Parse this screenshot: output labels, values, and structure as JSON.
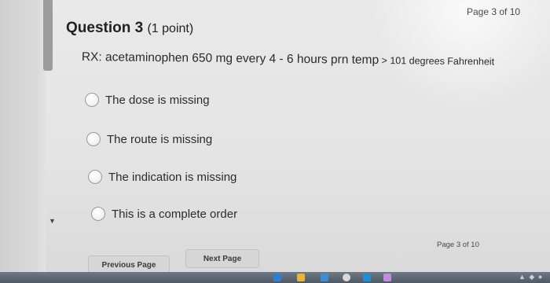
{
  "header": {
    "page_indicator": "Page 3 of 10"
  },
  "question": {
    "title": "Question 3",
    "points": "(1 point)",
    "text_main": "RX: acetaminophen 650 mg every 4 - 6 hours prn temp",
    "text_tail": " > 101 degrees Fahrenheit"
  },
  "options": [
    {
      "label": "The dose is missing"
    },
    {
      "label": "The route is missing"
    },
    {
      "label": "The indication is missing"
    },
    {
      "label": "This is a complete order"
    }
  ],
  "footer": {
    "page_indicator": "Page 3 of 10",
    "previous_label": "Previous Page",
    "next_label": "Next Page"
  },
  "taskbar": {
    "icons": [
      "browser-icon",
      "folder-icon",
      "store-icon",
      "chrome-icon",
      "app-icon",
      "app-icon"
    ],
    "colors": [
      "#2f7fd0",
      "#e8b43a",
      "#3b8fd6",
      "#d9d9d9",
      "#1f8fd1",
      "#c48be3"
    ]
  }
}
